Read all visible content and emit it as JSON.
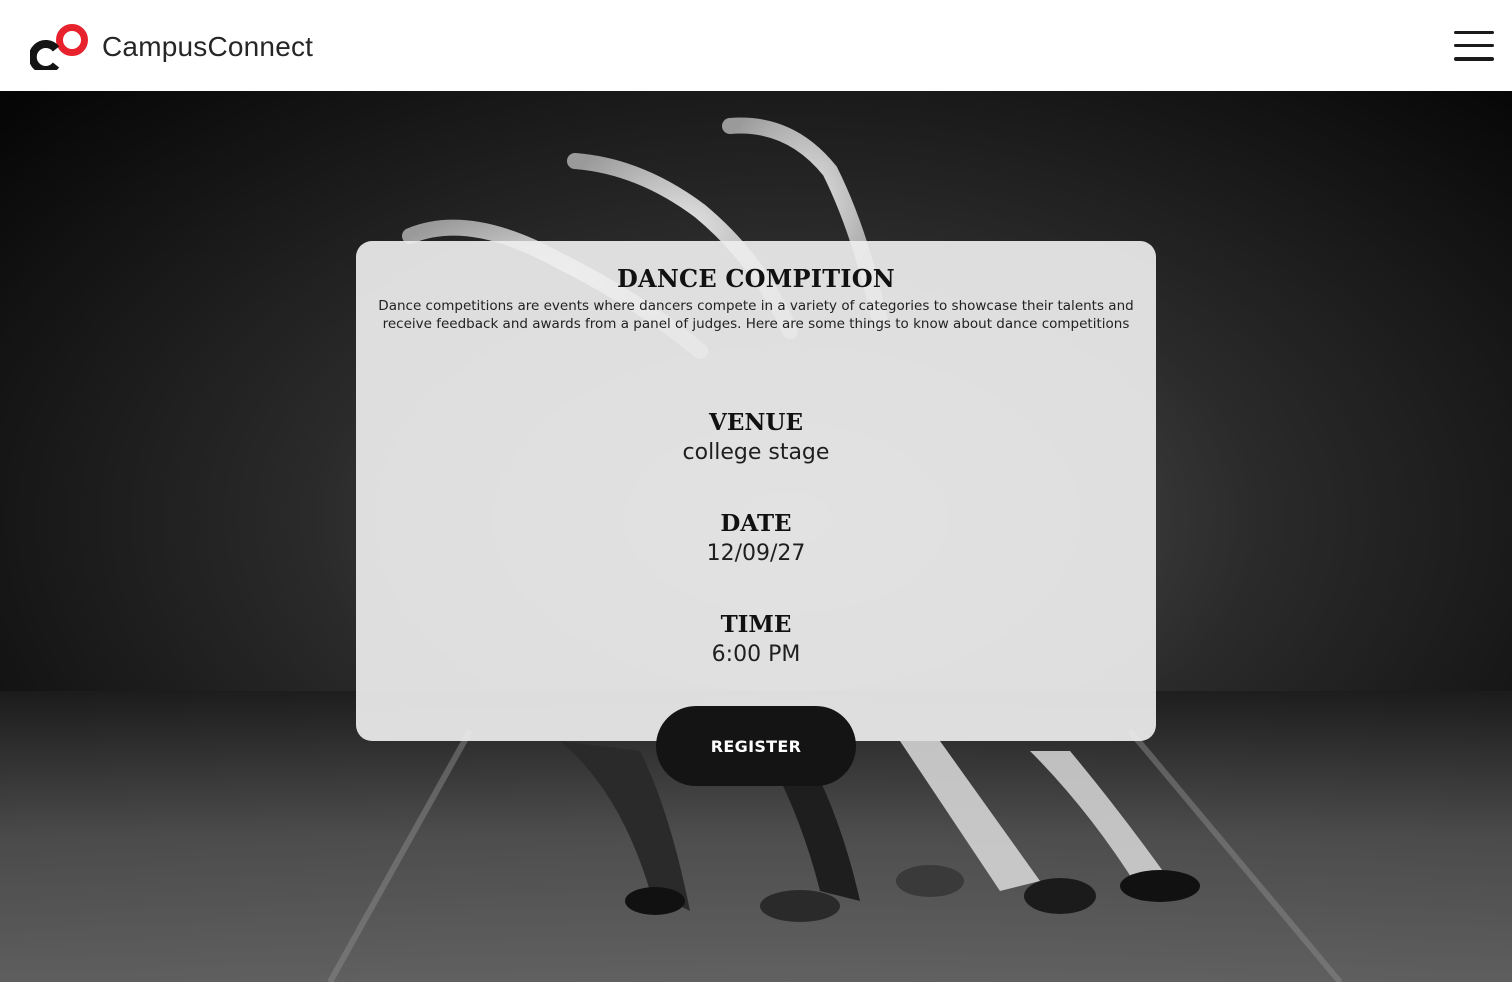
{
  "header": {
    "brand_name": "CampusConnect",
    "logo_icon": "campusconnect-logo",
    "menu_icon": "hamburger-menu-icon"
  },
  "hero": {
    "image": "black-and-white ballet dancers on stage"
  },
  "event": {
    "title": "DANCE COMPITION",
    "description": "Dance competitions are events where dancers compete in a variety of categories to showcase their talents and receive feedback and awards from a panel of judges. Here are some things to know about dance competitions",
    "venue_label": "VENUE",
    "venue_value": "college stage",
    "date_label": "DATE",
    "date_value": "12/09/27",
    "time_label": "TIME",
    "time_value": "6:00 PM",
    "register_label": "REGISTER"
  },
  "colors": {
    "accent": "#e8222c",
    "header_bg": "#ffffff",
    "card_bg": "#eeeeee",
    "button_bg": "#141414"
  }
}
